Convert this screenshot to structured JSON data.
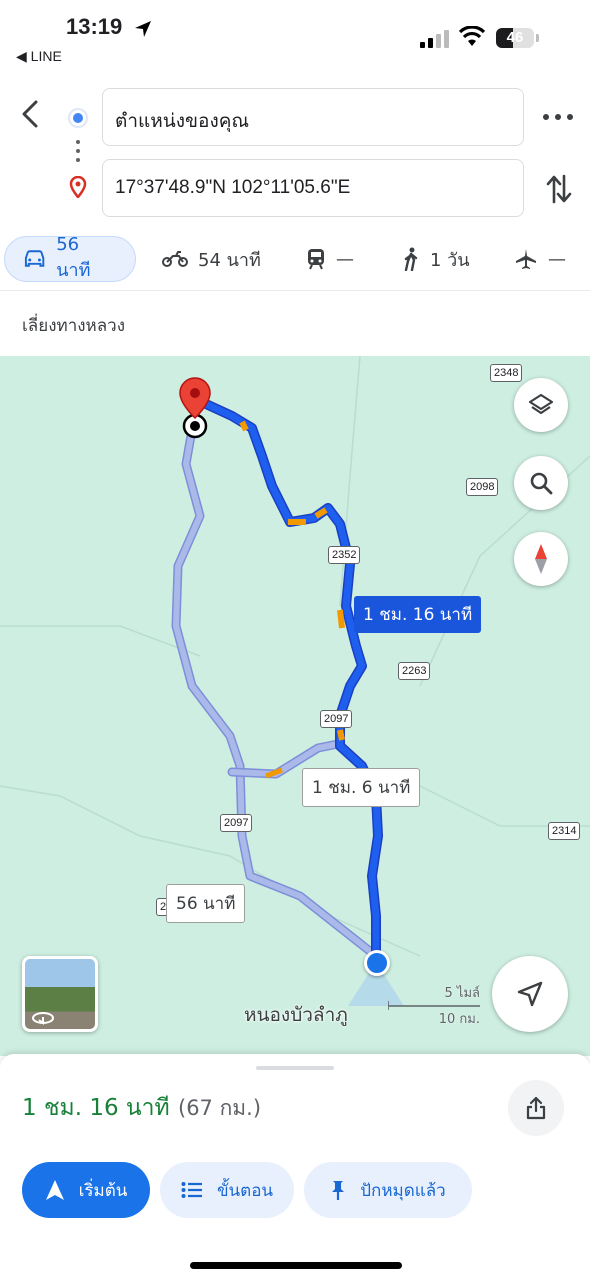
{
  "status_bar": {
    "time": "13:19",
    "back_app": "◀ LINE",
    "battery_level": "46",
    "battery_fraction": 0.46
  },
  "directions": {
    "origin": "ตำแหน่งของคุณ",
    "destination": "17°37'48.9\"N 102°11'05.6\"E"
  },
  "modes": [
    {
      "icon": "car-icon",
      "label": "56 นาที",
      "active": true
    },
    {
      "icon": "motorbike-icon",
      "label": "54 นาที"
    },
    {
      "icon": "transit-icon",
      "label": "—"
    },
    {
      "icon": "walk-icon",
      "label": "1 วัน"
    },
    {
      "icon": "flight-icon",
      "label": "—"
    }
  ],
  "route_option": "เลี่ยงทางหลวง",
  "map": {
    "road_numbers": [
      "2348",
      "2098",
      "2352",
      "2263",
      "2097",
      "2097",
      "2314",
      "2"
    ],
    "route_labels": {
      "primary": "1 ชม. 16 นาที",
      "alt1": "1 ชม. 6 นาที",
      "alt2": "56 นาที"
    },
    "town": "หนองบัวลำภู",
    "scale": {
      "imperial": "5 ไมล์",
      "metric": "10 กม."
    },
    "colors": {
      "route": "#1a56db",
      "alt_route": "#aab9ea",
      "traffic": "#f29900",
      "map_bg": "#cdeee0"
    }
  },
  "summary": {
    "duration": "1 ชม. 16 นาที",
    "distance": "(67 กม.)"
  },
  "actions": {
    "start": "เริ่มต้น",
    "steps": "ขั้นตอน",
    "pinned": "ปักหมุดแล้ว"
  }
}
